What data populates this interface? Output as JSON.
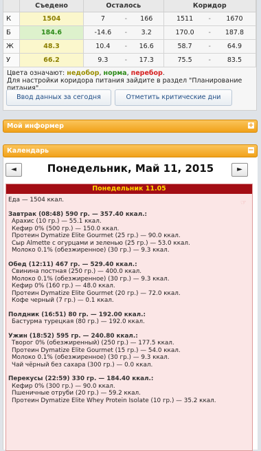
{
  "table": {
    "headers": [
      "",
      "Съедено",
      "Осталось",
      "Коридор"
    ],
    "rows": [
      {
        "label": "К",
        "eaten": "1504",
        "left_a": "7",
        "left_b": "166",
        "range_a": "1511",
        "range_b": "1670",
        "color": "yellow"
      },
      {
        "label": "Б",
        "eaten": "184.6",
        "left_a": "-14.6",
        "left_b": "3.2",
        "range_a": "170.0",
        "range_b": "187.8",
        "color": "green"
      },
      {
        "label": "Ж",
        "eaten": "48.3",
        "left_a": "10.4",
        "left_b": "16.6",
        "range_a": "58.7",
        "range_b": "64.9",
        "color": "yellow"
      },
      {
        "label": "У",
        "eaten": "66.2",
        "left_a": "9.3",
        "left_b": "17.3",
        "range_a": "75.5",
        "range_b": "83.5",
        "color": "yellow"
      }
    ],
    "separator": "-"
  },
  "legend": {
    "prefix": "Цвета означают:",
    "under": "недобор",
    "norm": "норма",
    "over": "перебор",
    "note": "Для настройки коридора питания зайдите в раздел \"Планирование питания\"."
  },
  "buttons": {
    "enter_today": "Ввод данных за сегодня",
    "mark_critical": "Отметить критические дни"
  },
  "informer": {
    "label": "Мой информер",
    "sign": "+"
  },
  "calendar": {
    "label": "Календарь",
    "sign": "−",
    "prev": "◄",
    "next": "►",
    "date_title": "Понедельник, Май 11, 2015",
    "day_header": "Понедельник 11.05",
    "total": "Еда — 1504 ккал.",
    "meals": [
      {
        "title": "Завтрак (08:48) 590 гр. — 357.40 ккал.:",
        "items": [
          "Арахис (10 гр.) — 55.1 ккал.",
          "Кефир 0% (500 гр.) — 150.0 ккал.",
          "Протеин Dymatize Elite Gourmet (25 гр.) — 90.0 ккал.",
          "Сыр Almette с огурцами и зеленью (25 гр.) — 53.0 ккал.",
          "Молоко 0.1% (обезжиренное) (30 гр.) — 9.3 ккал."
        ]
      },
      {
        "title": "Обед (12:11) 467 гр. — 529.40 ккал.:",
        "items": [
          "Свинина постная (250 гр.) — 400.0 ккал.",
          "Молоко 0.1% (обезжиренное) (30 гр.) — 9.3 ккал.",
          "Кефир 0% (160 гр.) — 48.0 ккал.",
          "Протеин Dymatize Elite Gourmet (20 гр.) — 72.0 ккал.",
          "Кофе черный (7 гр.) — 0.1 ккал."
        ]
      },
      {
        "title": "Полдник (16:51) 80 гр. — 192.00 ккал.:",
        "items": [
          "Бастурма турецкая (80 гр.) — 192.0 ккал."
        ]
      },
      {
        "title": "Ужин (18:52) 595 гр. — 240.80 ккал.:",
        "items": [
          "Творог 0% (обезжиренный) (250 гр.) — 177.5 ккал.",
          "Протеин Dymatize Elite Gourmet (15 гр.) — 54.0 ккал.",
          "Молоко 0.1% (обезжиренное) (30 гр.) — 9.3 ккал.",
          "Чай чёрный без сахара (300 гр.) — 0.0 ккал."
        ]
      },
      {
        "title": "Перекусы (22:59) 330 гр. — 184.40 ккал.:",
        "items": [
          "Кефир 0% (300 гр.) — 90.0 ккал.",
          "Пшеничные отруби (20 гр.) — 59.2 ккал.",
          "Протеин Dymatize Elite Whey Protein Isolate (10 гр.) — 35.2 ккал."
        ]
      }
    ]
  },
  "colors": {
    "yellow": "#fbf7cc",
    "green": "#ddf1cc",
    "day_header_bg": "#a30d14",
    "day_header_text": "#ffd700",
    "bar_orange": "#f1a21a"
  },
  "icons": {
    "prev": "arrow-left-icon",
    "next": "arrow-right-icon",
    "plus": "plus-icon",
    "minus": "minus-icon",
    "hand": "hand-pointer-icon"
  }
}
